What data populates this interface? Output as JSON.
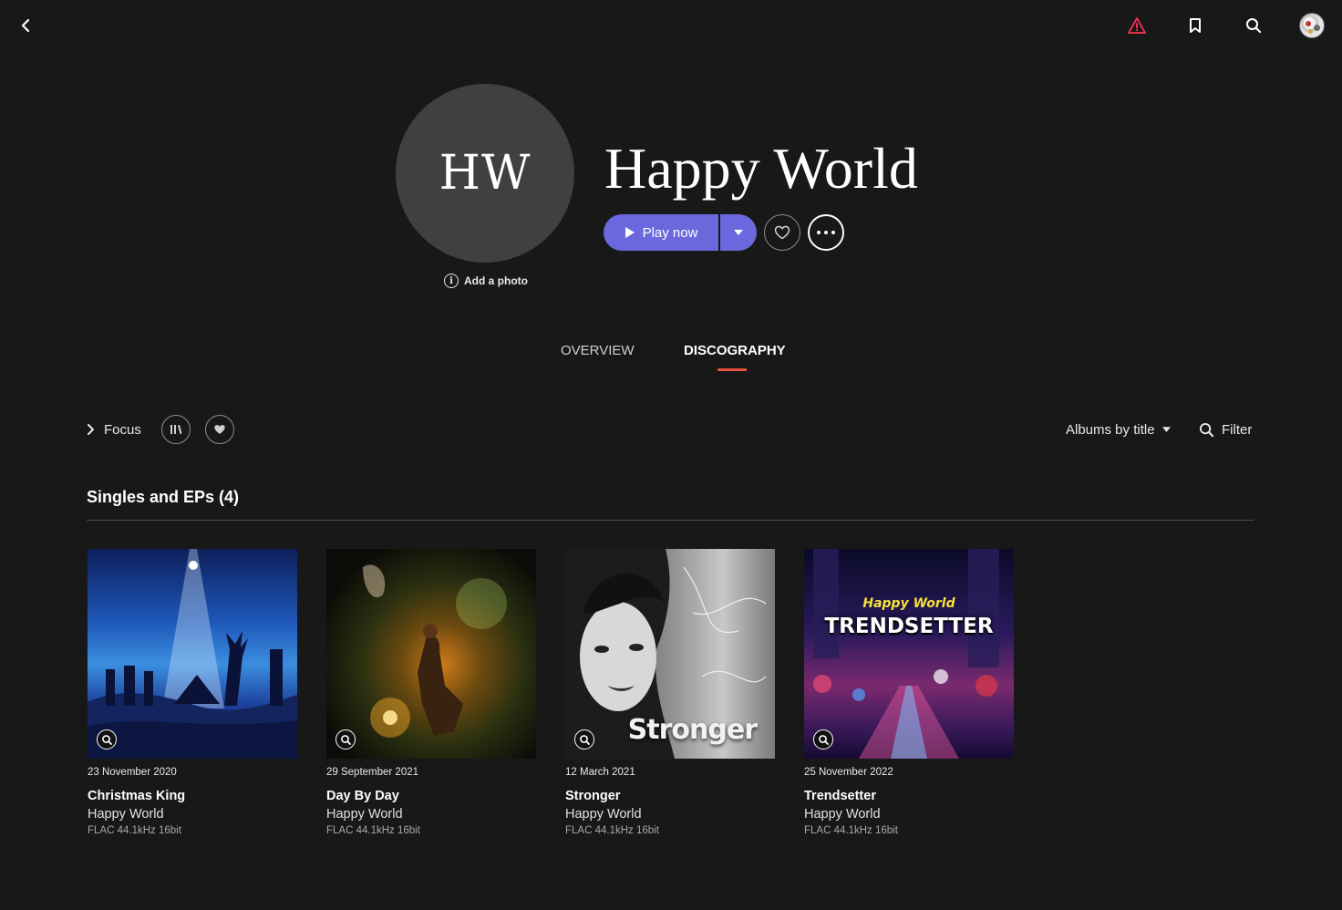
{
  "colors": {
    "background": "#181818",
    "accent": "#6b68dd",
    "alert": "#e0304e",
    "tab_underline": "#e5533e"
  },
  "topbar": {
    "icons": [
      "back-chevron-icon",
      "alert-triangle-icon",
      "bookmark-icon",
      "search-icon",
      "user-avatar"
    ]
  },
  "artist": {
    "initials": "HW",
    "name": "Happy World",
    "add_photo_label": "Add a photo"
  },
  "actions": {
    "play_label": "Play now"
  },
  "tabs": [
    {
      "label": "OVERVIEW",
      "active": false
    },
    {
      "label": "DISCOGRAPHY",
      "active": true
    }
  ],
  "toolbar": {
    "focus_label": "Focus",
    "sort_label": "Albums by title",
    "filter_label": "Filter"
  },
  "section": {
    "title": "Singles and EPs (4)"
  },
  "albums": [
    {
      "date": "23 November 2020",
      "title": "Christmas King",
      "artist": "Happy World",
      "quality": "FLAC 44.1kHz 16bit"
    },
    {
      "date": "29 September 2021",
      "title": "Day By Day",
      "artist": "Happy World",
      "quality": "FLAC 44.1kHz 16bit"
    },
    {
      "date": "12 March 2021",
      "title": "Stronger",
      "artist": "Happy World",
      "quality": "FLAC 44.1kHz 16bit",
      "cover_text": "Stronger"
    },
    {
      "date": "25 November 2022",
      "title": "Trendsetter",
      "artist": "Happy World",
      "quality": "FLAC 44.1kHz 16bit",
      "cover_text_top": "Happy World",
      "cover_text_main": "TRENDSETTER"
    }
  ]
}
